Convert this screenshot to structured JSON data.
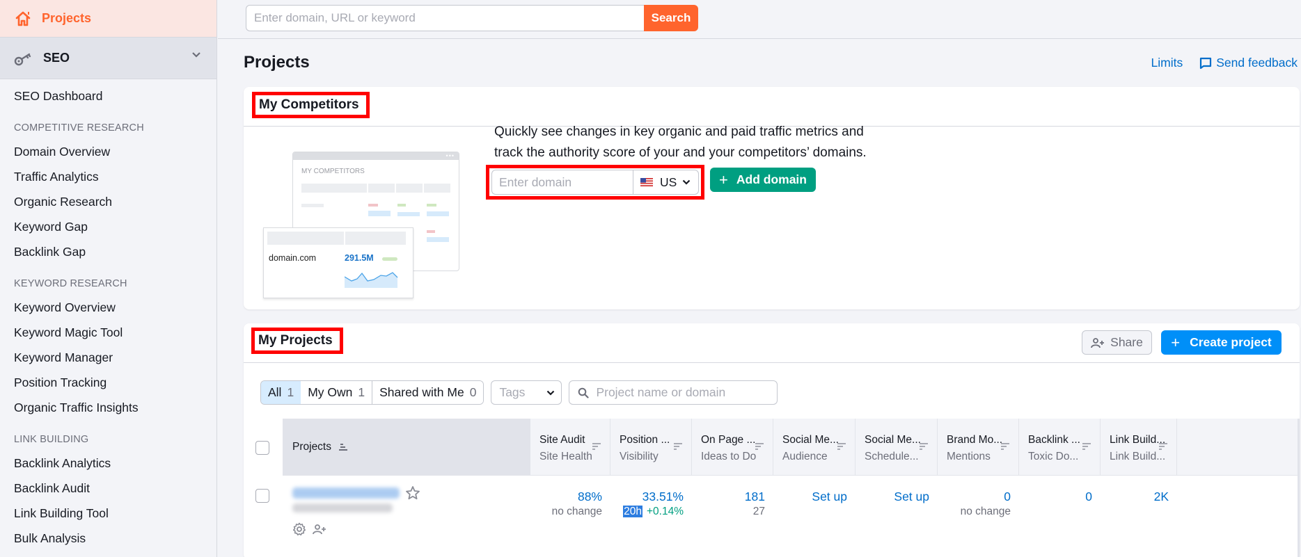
{
  "sidebar": {
    "projects_label": "Projects",
    "seo_label": "SEO",
    "dashboard": "SEO Dashboard",
    "sections": [
      {
        "title": "COMPETITIVE RESEARCH",
        "items": [
          "Domain Overview",
          "Traffic Analytics",
          "Organic Research",
          "Keyword Gap",
          "Backlink Gap"
        ]
      },
      {
        "title": "KEYWORD RESEARCH",
        "items": [
          "Keyword Overview",
          "Keyword Magic Tool",
          "Keyword Manager",
          "Position Tracking",
          "Organic Traffic Insights"
        ]
      },
      {
        "title": "LINK BUILDING",
        "items": [
          "Backlink Analytics",
          "Backlink Audit",
          "Link Building Tool",
          "Bulk Analysis"
        ]
      }
    ]
  },
  "topbar": {
    "search_placeholder": "Enter domain, URL or keyword",
    "search_button": "Search"
  },
  "page": {
    "title": "Projects",
    "limits_link": "Limits",
    "feedback_link": "Send feedback"
  },
  "competitors": {
    "title": "My Competitors",
    "illustration": {
      "window_title": "MY COMPETITORS",
      "domain": "domain.com",
      "value": "291.5M"
    },
    "description": "Quickly see changes in key organic and paid traffic metrics and track the authority score of your and your competitors’ domains.",
    "domain_placeholder": "Enter domain",
    "country": "US",
    "add_button": "Add domain"
  },
  "projects": {
    "title": "My Projects",
    "share_button": "Share",
    "create_button": "Create project",
    "filters": [
      {
        "label": "All",
        "count": "1",
        "active": true
      },
      {
        "label": "My Own",
        "count": "1",
        "active": false
      },
      {
        "label": "Shared with Me",
        "count": "0",
        "active": false
      }
    ],
    "tags_placeholder": "Tags",
    "search_placeholder": "Project name or domain",
    "columns": [
      {
        "title": "Site Audit",
        "sub": "Site Health"
      },
      {
        "title": "Position ...",
        "sub": "Visibility"
      },
      {
        "title": "On Page ...",
        "sub": "Ideas to Do"
      },
      {
        "title": "Social Me...",
        "sub": "Audience"
      },
      {
        "title": "Social Me...",
        "sub": "Schedule..."
      },
      {
        "title": "Brand Mo...",
        "sub": "Mentions"
      },
      {
        "title": "Backlink ...",
        "sub": "Toxic Do..."
      },
      {
        "title": "Link Build...",
        "sub": "Link Build..."
      }
    ],
    "projects_column": "Projects",
    "rows": [
      {
        "cells": [
          {
            "main": "88%",
            "sub": "no change"
          },
          {
            "main": "33.51%",
            "badge": "20h",
            "delta": "+0.14%"
          },
          {
            "main": "181",
            "sub": "27"
          },
          {
            "main": "Set up"
          },
          {
            "main": "Set up"
          },
          {
            "main": "0",
            "sub": "no change"
          },
          {
            "main": "0"
          },
          {
            "main": "2K"
          }
        ]
      }
    ]
  }
}
